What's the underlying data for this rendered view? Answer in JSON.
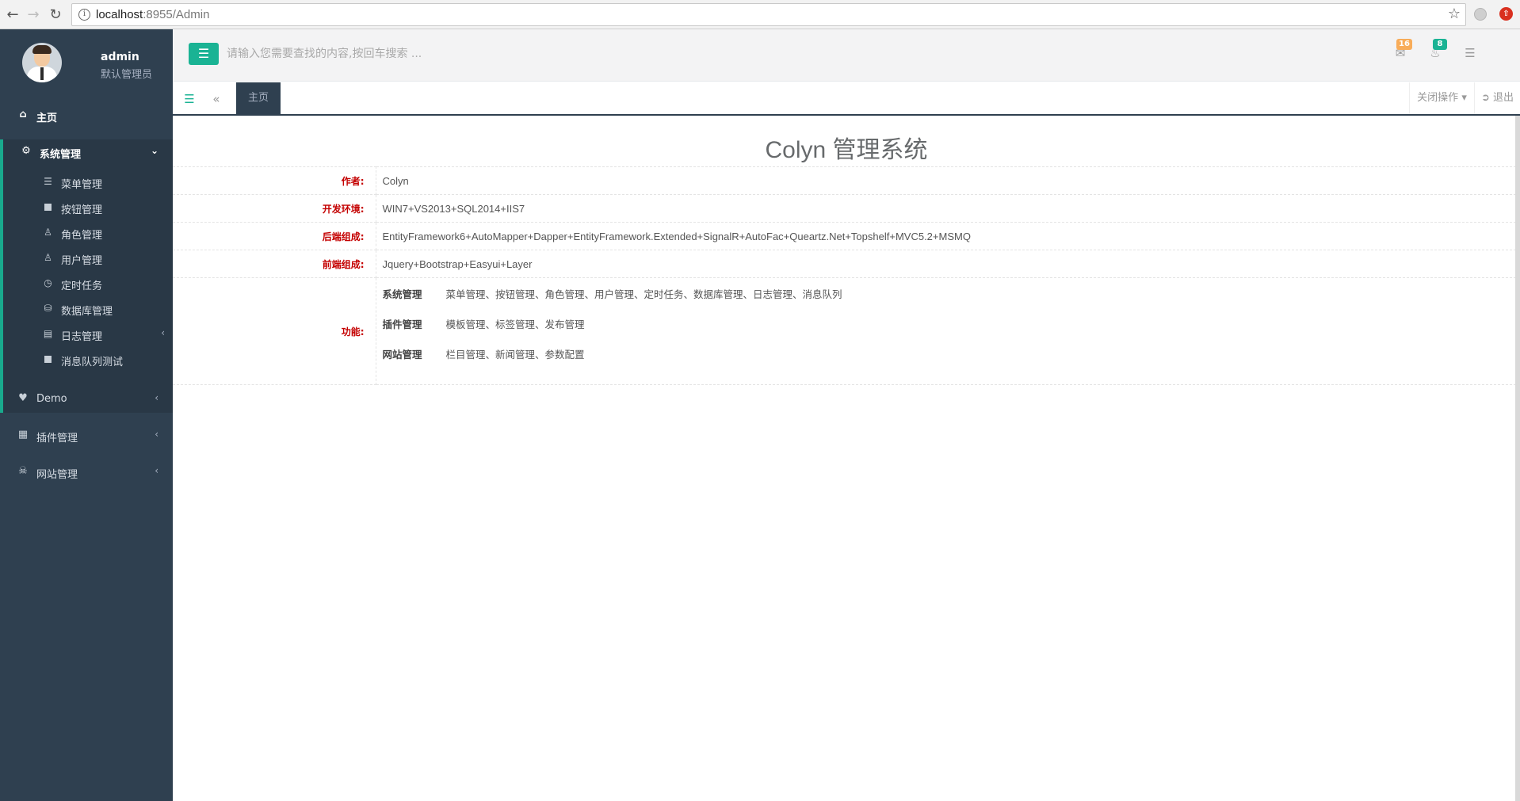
{
  "browser": {
    "url_host": "localhost",
    "url_rest": ":8955/Admin"
  },
  "profile": {
    "name": "admin",
    "role": "默认管理员"
  },
  "sidebar": {
    "home": "主页",
    "system": {
      "label": "系统管理",
      "items": [
        {
          "label": "菜单管理",
          "icon": "list-icon"
        },
        {
          "label": "按钮管理",
          "icon": "square-icon"
        },
        {
          "label": "角色管理",
          "icon": "user-icon"
        },
        {
          "label": "用户管理",
          "icon": "user-icon"
        },
        {
          "label": "定时任务",
          "icon": "clock-icon"
        },
        {
          "label": "数据库管理",
          "icon": "database-icon"
        },
        {
          "label": "日志管理",
          "icon": "book-icon"
        },
        {
          "label": "消息队列测试",
          "icon": "square-icon"
        }
      ]
    },
    "demo": "Demo",
    "plugins": "插件管理",
    "website": "网站管理"
  },
  "topbar": {
    "search_placeholder": "请输入您需要查找的内容,按回车搜索 ...",
    "mail_count": "16",
    "bell_count": "8"
  },
  "tabs": {
    "home": "主页",
    "close_ops": "关闭操作",
    "logout": "退出"
  },
  "main": {
    "title": "Colyn 管理系统",
    "rows": [
      {
        "label": "作者:",
        "value": "Colyn"
      },
      {
        "label": "开发环境:",
        "value": "WIN7+VS2013+SQL2014+IIS7"
      },
      {
        "label": "后端组成:",
        "value": "EntityFramework6+AutoMapper+Dapper+EntityFramework.Extended+SignalR+AutoFac+Queartz.Net+Topshelf+MVC5.2+MSMQ"
      },
      {
        "label": "前端组成:",
        "value": "Jquery+Bootstrap+Easyui+Layer"
      }
    ],
    "functions_label": "功能:",
    "functions": [
      {
        "name": "系统管理",
        "items": "菜单管理、按钮管理、角色管理、用户管理、定时任务、数据库管理、日志管理、消息队列"
      },
      {
        "name": "插件管理",
        "items": "模板管理、标签管理、发布管理"
      },
      {
        "name": "网站管理",
        "items": "栏目管理、新闻管理、参数配置"
      }
    ]
  },
  "colors": {
    "sidebar_bg": "#2f4050",
    "accent": "#1ab394",
    "label_red": "#c40000",
    "mail_badge": "#f8ac59",
    "bell_badge": "#1ab394"
  }
}
